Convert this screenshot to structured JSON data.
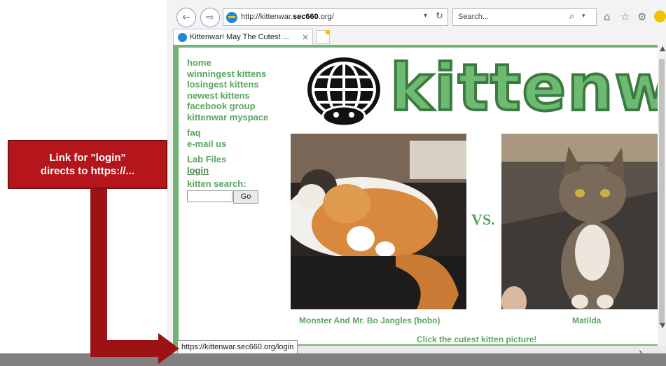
{
  "browser": {
    "url_prefix": "http://kittenwar.",
    "url_domain": "sec660",
    "url_suffix": ".org/",
    "search_placeholder": "Search...",
    "tab_title": "Kittenwar! May The Cutest ...",
    "status_url": "https://kittenwar.sec660.org/login"
  },
  "page": {
    "nav_group1": [
      "home",
      "winningest kittens",
      "losingest kittens",
      "newest kittens",
      "facebook group",
      "kittenwar myspace"
    ],
    "nav_group2": [
      "faq",
      "e-mail us"
    ],
    "lab_files": "Lab Files",
    "login": "login",
    "search_label": "kitten search:",
    "search_button": "Go",
    "logo_text": "kittenwar",
    "vs": "VS.",
    "kitten1_caption": "Monster And Mr. Bo Jangles (bobo)",
    "kitten2_caption": "Matilda",
    "instruction": "Click the cutest kitten picture!"
  },
  "callout": {
    "line1": "Link for \"login\"",
    "line2": "directs to https://..."
  },
  "colors": {
    "callout_red": "#b4161b",
    "kittenwar_green": "#5aa55f",
    "frame_green": "#72b373"
  },
  "icons": [
    "back-icon",
    "forward-icon",
    "ie-icon",
    "refresh-icon",
    "search-icon",
    "home-icon",
    "favorites-star-icon",
    "settings-gear-icon",
    "smiley-icon",
    "close-tab-icon",
    "globe-logo-icon",
    "red-arrow-icon"
  ]
}
